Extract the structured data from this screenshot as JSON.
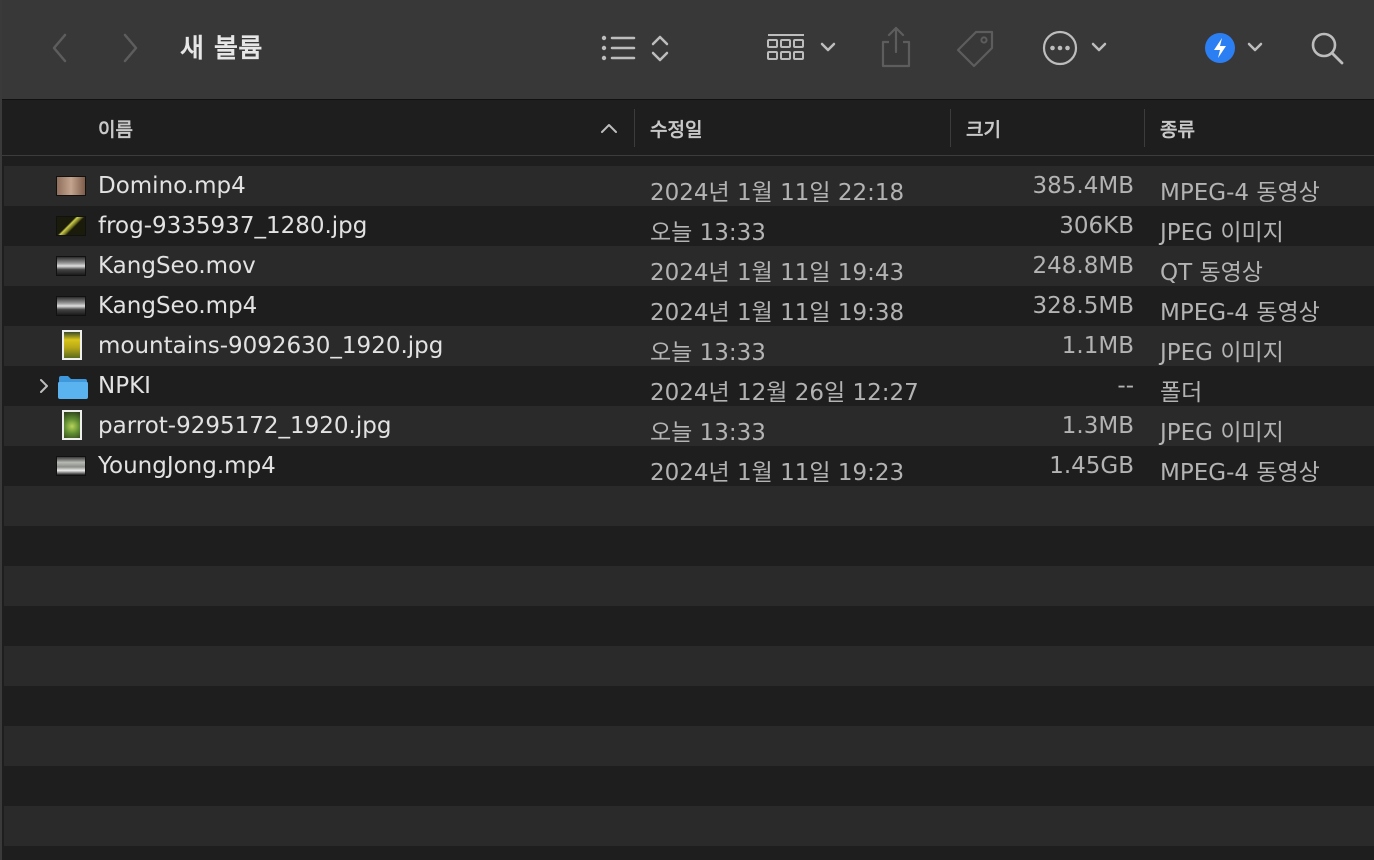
{
  "window": {
    "title": "새 볼륨"
  },
  "toolbar": {
    "back": "chevron-left-icon",
    "forward": "chevron-right-icon",
    "view_list": "list-view-icon",
    "group": "grid-group-icon",
    "share": "share-icon",
    "tags": "tag-icon",
    "more": "ellipsis-circle-icon",
    "airdrop": "action-icon",
    "search": "search-icon"
  },
  "columns": {
    "name": "이름",
    "modified": "수정일",
    "size": "크기",
    "kind": "종류"
  },
  "files": [
    {
      "name": "Domino.mp4",
      "modified": "2024년 1월 11일 22:18",
      "size": "385.4MB",
      "kind": "MPEG-4 동영상",
      "icon": "video-thumbnail",
      "thumb_color": "#a58672"
    },
    {
      "name": "frog-9335937_1280.jpg",
      "modified": "오늘 13:33",
      "size": "306KB",
      "kind": "JPEG 이미지",
      "icon": "image-thumbnail",
      "thumb_color": "#8a8a2a"
    },
    {
      "name": "KangSeo.mov",
      "modified": "2024년 1월 11일 19:43",
      "size": "248.8MB",
      "kind": "QT 동영상",
      "icon": "video-thumbnail",
      "thumb_color": "#7c7c7c"
    },
    {
      "name": "KangSeo.mp4",
      "modified": "2024년 1월 11일 19:38",
      "size": "328.5MB",
      "kind": "MPEG-4 동영상",
      "icon": "video-thumbnail",
      "thumb_color": "#7c7c7c"
    },
    {
      "name": "mountains-9092630_1920.jpg",
      "modified": "오늘 13:33",
      "size": "1.1MB",
      "kind": "JPEG 이미지",
      "icon": "image-thumbnail-portrait",
      "thumb_color": "#b8a81a"
    },
    {
      "name": "NPKI",
      "modified": "2024년 12월 26일 12:27",
      "size": "--",
      "kind": "폴더",
      "icon": "folder-icon",
      "thumb_color": "#5ab2ee"
    },
    {
      "name": "parrot-9295172_1920.jpg",
      "modified": "오늘 13:33",
      "size": "1.3MB",
      "kind": "JPEG 이미지",
      "icon": "image-thumbnail-portrait",
      "thumb_color": "#7aa44a"
    },
    {
      "name": "YoungJong.mp4",
      "modified": "2024년 1월 11일 19:23",
      "size": "1.45GB",
      "kind": "MPEG-4 동영상",
      "icon": "video-thumbnail",
      "thumb_color": "#8c8f88"
    }
  ],
  "colors": {
    "toolbar_bg": "#383838",
    "list_bg": "#1e1e1e",
    "stripe_bg": "#2a2a2a",
    "folder_blue": "#5ab2ee",
    "accent_blue": "#2c7ff3"
  }
}
